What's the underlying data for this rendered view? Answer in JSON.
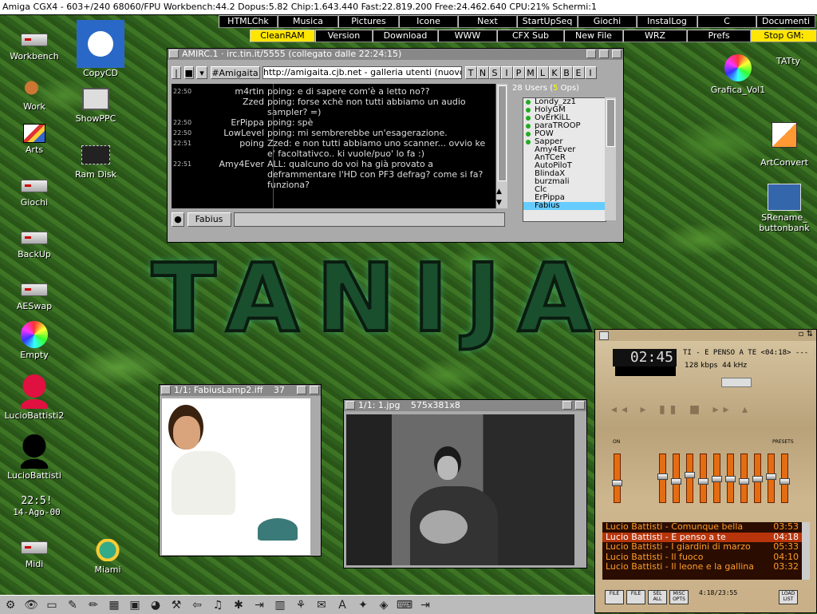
{
  "screen": {
    "title": "Amiga CGX4 - 603+/240  68060/FPU Workbench:44.2  Dopus:5.82 Chip:1.643.440 Fast:22.819.200 Free:24.462.640 CPU:21% Schermi:1"
  },
  "toolbar": {
    "row1": [
      "HTMLChk",
      "Musica",
      "Pictures",
      "Icone",
      "Next",
      "StartUpSeq",
      "Giochi",
      "InstalLog",
      "C",
      "Documenti"
    ],
    "row2": [
      "CleanRAM",
      "Version",
      "Download",
      "WWW",
      "CFX Sub",
      "New File",
      "WRZ",
      "Prefs",
      "Stop GM:"
    ]
  },
  "desktop_icons": {
    "left": [
      "Workbench",
      "Work",
      "Arts",
      "Giochi",
      "BackUp",
      "AESwap",
      "Empty",
      "LucioBattisti2",
      "LucioBattisti",
      "Midi"
    ],
    "second": [
      "CopyCD",
      "ShowPPC",
      "Ram Disk",
      "Miami"
    ],
    "right": [
      "TATty",
      "Grafica_Vol1",
      "ArtConvert",
      "SRename_\nbuttonbank"
    ]
  },
  "clock": {
    "time": "22:5!",
    "date": "14-Ago-00"
  },
  "logo_text": "TANIJA",
  "irc": {
    "title": "AMIRC.1 · irc.tin.it/5555 (collegato dalle 22:24:15)",
    "channel": "#Amigaita",
    "topic": "http://amigaita.cjb.net - galleria utenti (nuovo",
    "modes": [
      "T",
      "N",
      "S",
      "I",
      "P",
      "M",
      "L",
      "K",
      "B",
      "E",
      "I"
    ],
    "users_count": "28",
    "users_label": "Users",
    "ops_count": "5",
    "ops_label": "Ops",
    "nick": "Fabius",
    "messages": [
      {
        "ts": "22:50",
        "nick": "m4rtin",
        "text": "poing: e di sapere com'è a letto no??"
      },
      {
        "ts": "",
        "nick": "Zzed",
        "text": "poing: forse xchè non tutti abbiamo un audio sampler? =)"
      },
      {
        "ts": "22:50",
        "nick": "ErPippa",
        "text": "poing: spè"
      },
      {
        "ts": "22:50",
        "nick": "LowLevel",
        "text": "poing: mi sembrerebbe un'esagerazione."
      },
      {
        "ts": "22:51",
        "nick": "poing",
        "text": "Zzed: e non tutti abbiamo uno scanner... ovvio ke e' facoltativco.. ki vuole/puo' lo fa :)"
      },
      {
        "ts": "22:51",
        "nick": "Amy4Ever",
        "text": "ALL: qualcuno do voi ha già provato a deframmentare l'HD con PF3 defrag? come si fa? funziona?"
      }
    ],
    "users": [
      {
        "name": "Londy_zz1",
        "op": true
      },
      {
        "name": "HolyGM",
        "op": true
      },
      {
        "name": "OvErKiLL",
        "op": true
      },
      {
        "name": "paraTROOP",
        "op": true
      },
      {
        "name": "POW",
        "op": true
      },
      {
        "name": "Sapper",
        "op": true
      },
      {
        "name": "Amy4Ever",
        "op": false
      },
      {
        "name": "AnTCeR",
        "op": false
      },
      {
        "name": "AutoPiloT",
        "op": false
      },
      {
        "name": "BlindaX",
        "op": false
      },
      {
        "name": "burzmali",
        "op": false
      },
      {
        "name": "Clc",
        "op": false
      },
      {
        "name": "ErPippa",
        "op": false
      },
      {
        "name": "Fabius",
        "op": false
      }
    ]
  },
  "viewer1": {
    "title": "1/1: FabiusLamp2.iff",
    "extra": "37"
  },
  "viewer2": {
    "title": "1/1: 1.jpg",
    "size": "575x381x8"
  },
  "player": {
    "time": "02:45",
    "title_scroll": "TI - E PENSO A TE",
    "track_len": "<04:18>",
    "bitrate": "128",
    "bitrate_unit": "kbps",
    "samplerate": "44",
    "samplerate_unit": "kHz",
    "eq_label_on": "ON",
    "eq_label_presets": "PRESETS",
    "eq_values": [
      0.4,
      0.55,
      0.45,
      0.6,
      0.45,
      0.5,
      0.5,
      0.45,
      0.5,
      0.55,
      0.45
    ],
    "playlist": [
      {
        "title": "Lucio Battisti - Comunque bella",
        "len": "03:53"
      },
      {
        "title": "Lucio Battisti - E penso a te",
        "len": "04:18",
        "current": true
      },
      {
        "title": "Lucio Battisti - I giardini di marzo",
        "len": "05:33"
      },
      {
        "title": "Lucio Battisti - Il fuoco",
        "len": "04:10"
      },
      {
        "title": "Lucio Battisti - Il leone e la gallina",
        "len": "03:32"
      }
    ],
    "buttons": [
      "FILE",
      "FILE",
      "SEL ALL",
      "MISC OPTS",
      "LOAD LIST"
    ],
    "counter": "4:18/23:55"
  },
  "taskbar": {
    "icons": [
      "settings-icon",
      "eye-icon",
      "screen-icon",
      "gear-icon",
      "paint-icon",
      "disk-icon",
      "box-icon",
      "palette-icon",
      "tools-icon",
      "arrow-icon",
      "sound-icon",
      "bug-icon",
      "exit-icon",
      "monitor-icon",
      "network-icon",
      "mail-icon",
      "font-icon",
      "star-icon",
      "game-icon",
      "keyboard-icon",
      "exit2-icon"
    ]
  }
}
